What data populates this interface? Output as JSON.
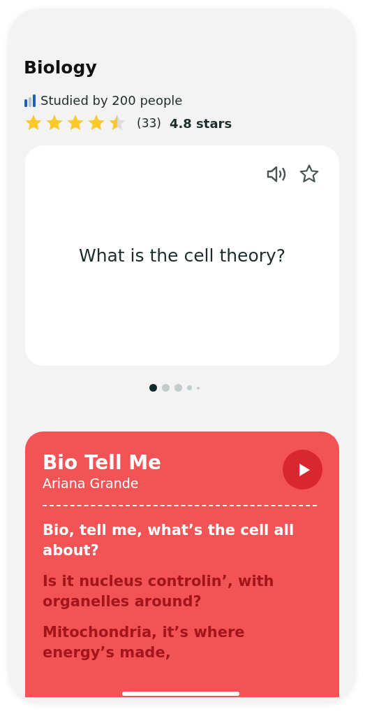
{
  "deck": {
    "title": "Biology",
    "studied": "Studied by 200 people",
    "stars": 4.5,
    "rating_count": "(33)",
    "rating": "4.8 stars"
  },
  "flashcard": {
    "question": "What is the cell theory?",
    "starred": false
  },
  "pager": [
    {
      "selected": true
    },
    {
      "selected": false
    },
    {
      "selected": false
    },
    {
      "selected": false
    },
    {
      "selected": false
    }
  ],
  "song": {
    "title": "Bio Tell Me",
    "artist": "Ariana Grande",
    "lyrics": [
      {
        "text": "Bio, tell me, what’s the cell all about?",
        "active": true
      },
      {
        "text": "Is it nucleus controlin’, with organelles around?",
        "active": false
      },
      {
        "text": "Mitochondria, it’s where energy’s made,",
        "active": false
      }
    ]
  }
}
